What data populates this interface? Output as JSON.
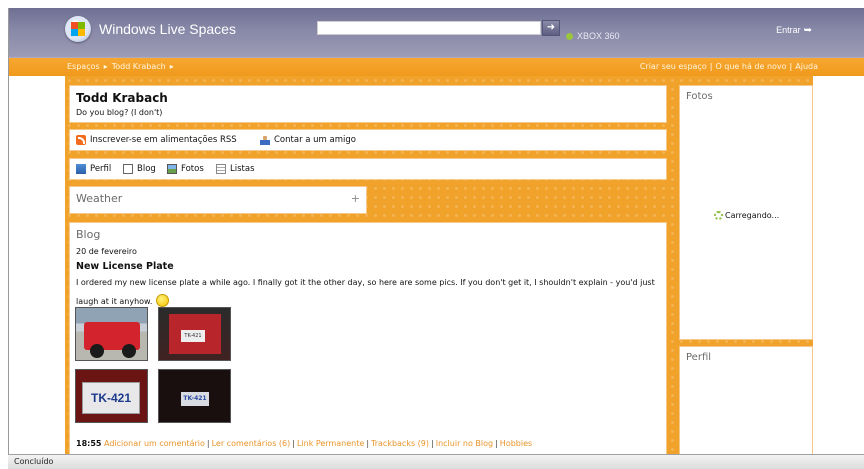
{
  "header": {
    "brand": "Windows Live Spaces",
    "xbox": "XBOX 360",
    "signin": "Entrar"
  },
  "nav": {
    "breadcrumb": [
      "Espaços",
      "Todd Krabach"
    ],
    "links": [
      "Criar seu espaço",
      "O que há de novo",
      "Ajuda"
    ]
  },
  "profile": {
    "name": "Todd Krabach",
    "tagline": "Do you blog? (I don't)"
  },
  "feeds": {
    "rss": "Inscrever-se em alimentações RSS",
    "tell_friend": "Contar a um amigo"
  },
  "tabs": [
    "Perfil",
    "Blog",
    "Fotos",
    "Listas"
  ],
  "weather": {
    "title": "Weather",
    "expand": "+"
  },
  "blog": {
    "title": "Blog",
    "date": "20 de fevereiro",
    "post_title": "New License Plate",
    "post_body": "I ordered my new license plate a while ago.  I finally got it the other day, so here are some pics.  If you don't get it, I shouldn't explain - you'd just laugh at it anyhow.",
    "plate_text": "TK-421",
    "time": "18:55",
    "footer_links": [
      "Adicionar um comentário",
      "Ler comentários (6)",
      "Link Permanente",
      "Trackbacks (9)",
      "Incluir no Blog",
      "Hobbies"
    ]
  },
  "sidebar": {
    "photos_title": "Fotos",
    "loading": "Carregando...",
    "perfil_title": "Perfil"
  },
  "status": {
    "text": "Concluído"
  },
  "colors": {
    "accent": "#f0a22b",
    "header": "#8888a8",
    "link": "#e8942a"
  }
}
